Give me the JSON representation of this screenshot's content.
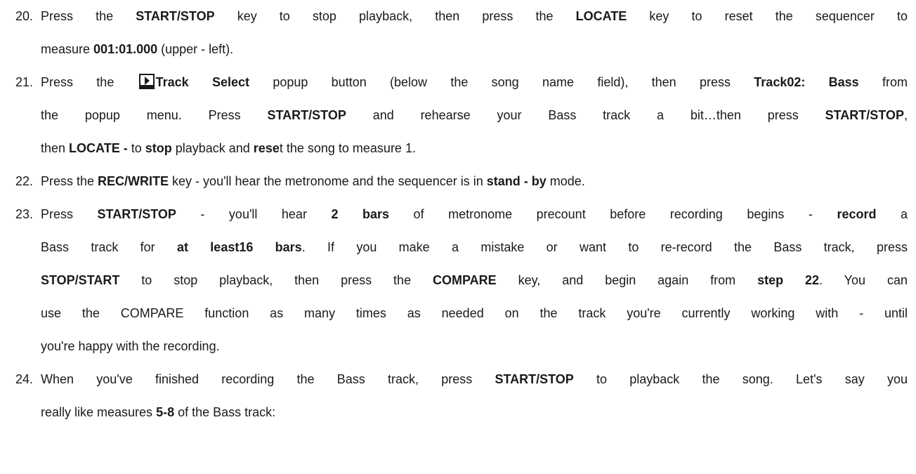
{
  "steps": [
    {
      "number": "20.",
      "lines": [
        [
          "Press the ",
          "START/STOP",
          " key to stop playback, then press the ",
          "LOCATE",
          " key to reset the sequencer to"
        ],
        [
          "measure ",
          "001:01.000",
          " (upper - left)."
        ]
      ]
    },
    {
      "number": "21.",
      "lines": [
        [
          "Press the ",
          "Track Select",
          " popup button (below the song name field), then press ",
          "Track02: Bass",
          " from"
        ],
        [
          "the popup menu. Press ",
          "START/STOP",
          " and rehearse your Bass track a bit…then press ",
          "START/STOP",
          ","
        ],
        [
          "then ",
          "LOCATE -",
          " to ",
          "stop",
          " playback and ",
          "rese",
          "t the song to measure 1."
        ]
      ]
    },
    {
      "number": "22.",
      "lines": [
        [
          "Press the ",
          "REC/WRITE",
          " key - you'll hear the metronome and the sequencer is in ",
          "stand - by",
          " mode."
        ]
      ]
    },
    {
      "number": "23.",
      "lines": [
        [
          "Press ",
          "START/STOP",
          " - you'll hear ",
          "2 bars",
          " of metronome precount before recording begins - ",
          "record",
          " a"
        ],
        [
          "Bass track for ",
          "at least16 bars",
          ". If you make a mistake or want to re-record the Bass track, press"
        ],
        [
          "STOP/START",
          " to stop playback, then press the ",
          "COMPARE",
          " key, and begin again from ",
          "step 22",
          ". You can"
        ],
        [
          "use the COMPARE function as many times as needed on the track you're currently working with - until"
        ],
        [
          "you're happy with the recording."
        ]
      ]
    },
    {
      "number": "24.",
      "lines": [
        [
          "When you've finished recording the Bass track, press ",
          "START/STOP",
          " to playback the song. Let's say you"
        ],
        [
          "really like measures ",
          "5-8",
          " of the Bass track:"
        ]
      ]
    }
  ],
  "icons": {
    "track_select": "play-triangle-icon"
  }
}
